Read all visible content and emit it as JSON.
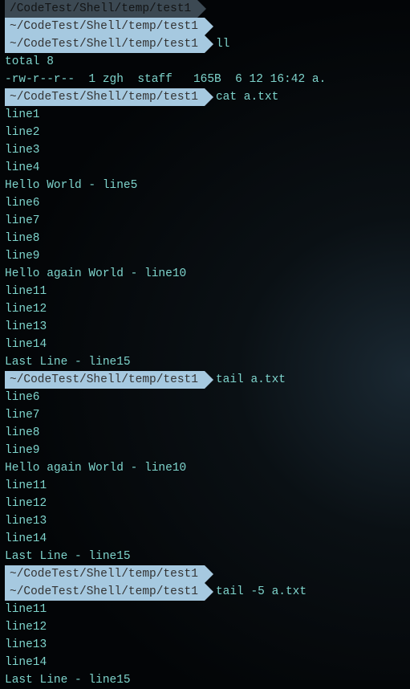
{
  "prompt_path": "~/CodeTest/Shell/temp/test1",
  "arrow": "▶",
  "blocks": [
    {
      "type": "prompt_dim_partial",
      "path": " /CodeTest/Shell/temp/test1"
    },
    {
      "type": "prompt_no_cmd",
      "path": "~/CodeTest/Shell/temp/test1"
    },
    {
      "type": "prompt",
      "path": "~/CodeTest/Shell/temp/test1",
      "cmd": "ll"
    },
    {
      "type": "output",
      "lines": [
        "total 8",
        "-rw-r--r--  1 zgh  staff   165B  6 12 16:42 a."
      ]
    },
    {
      "type": "prompt",
      "path": "~/CodeTest/Shell/temp/test1",
      "cmd": "cat a.txt"
    },
    {
      "type": "output",
      "lines": [
        "line1",
        "line2",
        "line3",
        "line4",
        "Hello World - line5",
        "line6",
        "line7",
        "line8",
        "line9",
        "Hello again World - line10",
        "line11",
        "line12",
        "line13",
        "line14",
        "Last Line - line15"
      ]
    },
    {
      "type": "prompt",
      "path": "~/CodeTest/Shell/temp/test1",
      "cmd": "tail a.txt"
    },
    {
      "type": "output",
      "lines": [
        "line6",
        "line7",
        "line8",
        "line9",
        "Hello again World - line10",
        "line11",
        "line12",
        "line13",
        "line14",
        "Last Line - line15"
      ]
    },
    {
      "type": "prompt_no_cmd",
      "path": "~/CodeTest/Shell/temp/test1"
    },
    {
      "type": "prompt",
      "path": "~/CodeTest/Shell/temp/test1",
      "cmd": "tail -5 a.txt"
    },
    {
      "type": "output",
      "lines": [
        "line11",
        "line12",
        "line13",
        "line14",
        "Last Line - line15"
      ]
    }
  ]
}
